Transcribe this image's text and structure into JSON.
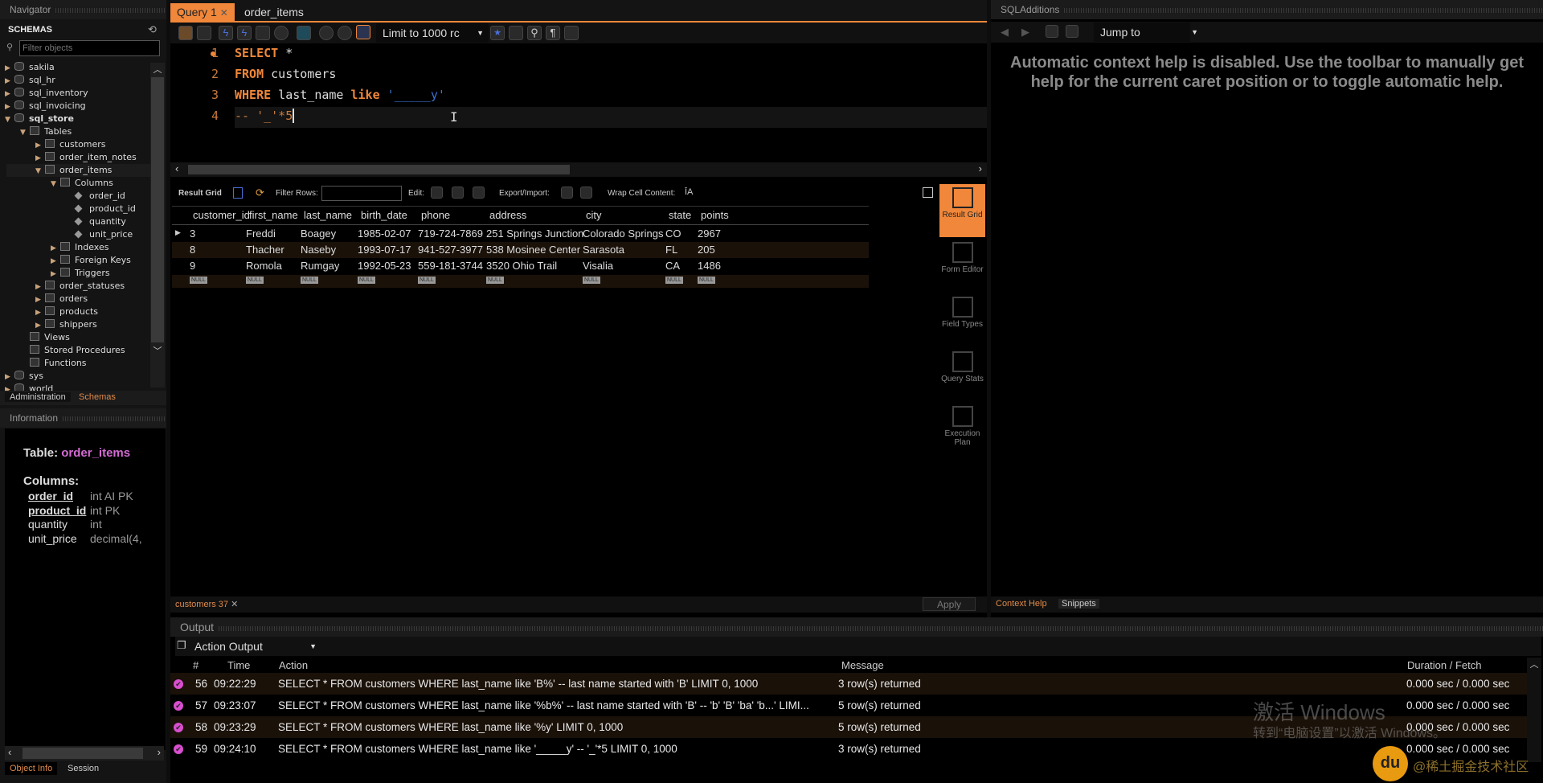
{
  "navigator": {
    "title": "Navigator",
    "schemas_label": "SCHEMAS",
    "filter_placeholder": "Filter objects",
    "tree": [
      {
        "label": "sakila",
        "depth": 0,
        "icon": "database",
        "state": "collapsed"
      },
      {
        "label": "sql_hr",
        "depth": 0,
        "icon": "database",
        "state": "collapsed"
      },
      {
        "label": "sql_inventory",
        "depth": 0,
        "icon": "database",
        "state": "collapsed"
      },
      {
        "label": "sql_invoicing",
        "depth": 0,
        "icon": "database",
        "state": "collapsed"
      },
      {
        "label": "sql_store",
        "depth": 0,
        "icon": "database",
        "state": "expanded",
        "bold": true
      },
      {
        "label": "Tables",
        "depth": 1,
        "icon": "folder",
        "state": "expanded"
      },
      {
        "label": "customers",
        "depth": 2,
        "icon": "table",
        "state": "collapsed"
      },
      {
        "label": "order_item_notes",
        "depth": 2,
        "icon": "table",
        "state": "collapsed"
      },
      {
        "label": "order_items",
        "depth": 2,
        "icon": "table",
        "state": "expanded",
        "selected": true
      },
      {
        "label": "Columns",
        "depth": 3,
        "icon": "folder",
        "state": "expanded"
      },
      {
        "label": "order_id",
        "depth": 4,
        "icon": "column"
      },
      {
        "label": "product_id",
        "depth": 4,
        "icon": "column"
      },
      {
        "label": "quantity",
        "depth": 4,
        "icon": "column"
      },
      {
        "label": "unit_price",
        "depth": 4,
        "icon": "column"
      },
      {
        "label": "Indexes",
        "depth": 3,
        "icon": "folder",
        "state": "collapsed"
      },
      {
        "label": "Foreign Keys",
        "depth": 3,
        "icon": "folder",
        "state": "collapsed"
      },
      {
        "label": "Triggers",
        "depth": 3,
        "icon": "folder",
        "state": "collapsed"
      },
      {
        "label": "order_statuses",
        "depth": 2,
        "icon": "table",
        "state": "collapsed"
      },
      {
        "label": "orders",
        "depth": 2,
        "icon": "table",
        "state": "collapsed"
      },
      {
        "label": "products",
        "depth": 2,
        "icon": "table",
        "state": "collapsed"
      },
      {
        "label": "shippers",
        "depth": 2,
        "icon": "table",
        "state": "collapsed"
      },
      {
        "label": "Views",
        "depth": 1,
        "icon": "folder"
      },
      {
        "label": "Stored Procedures",
        "depth": 1,
        "icon": "folder"
      },
      {
        "label": "Functions",
        "depth": 1,
        "icon": "folder"
      },
      {
        "label": "sys",
        "depth": 0,
        "icon": "database",
        "state": "collapsed"
      },
      {
        "label": "world",
        "depth": 0,
        "icon": "database",
        "state": "collapsed"
      }
    ],
    "tabs": [
      "Administration",
      "Schemas"
    ],
    "active_tab": "Schemas"
  },
  "information": {
    "title": "Information",
    "table_label": "Table:",
    "table_name": "order_items",
    "columns_label": "Columns:",
    "columns": [
      {
        "name": "order_id",
        "type": "int AI PK",
        "key": true
      },
      {
        "name": "product_id",
        "type": "int PK",
        "key": true
      },
      {
        "name": "quantity",
        "type": "int",
        "key": false
      },
      {
        "name": "unit_price",
        "type": "decimal(4,",
        "key": false
      }
    ],
    "tabs": [
      "Object Info",
      "Session"
    ]
  },
  "editor": {
    "tabs": [
      {
        "label": "Query 1",
        "active": true
      },
      {
        "label": "order_items",
        "active": false
      }
    ],
    "limit_select": "Limit to 1000 rc",
    "lines": [
      "1",
      "2",
      "3",
      "4"
    ]
  },
  "result": {
    "toolbar": {
      "result_grid": "Result Grid",
      "filter_rows": "Filter Rows:",
      "edit": "Edit:",
      "export_import": "Export/Import:",
      "wrap": "Wrap Cell Content:"
    },
    "columns": [
      "customer_id",
      "first_name",
      "last_name",
      "birth_date",
      "phone",
      "address",
      "city",
      "state",
      "points"
    ],
    "rows": [
      [
        "3",
        "Freddi",
        "Boagey",
        "1985-02-07",
        "719-724-7869",
        "251 Springs Junction",
        "Colorado Springs",
        "CO",
        "2967"
      ],
      [
        "8",
        "Thacher",
        "Naseby",
        "1993-07-17",
        "941-527-3977",
        "538 Mosinee Center",
        "Sarasota",
        "FL",
        "205"
      ],
      [
        "9",
        "Romola",
        "Rumgay",
        "1992-05-23",
        "559-181-3744",
        "3520 Ohio Trail",
        "Visalia",
        "CA",
        "1486"
      ]
    ],
    "null_label": "NULL",
    "side_tabs": [
      "Result Grid",
      "Form Editor",
      "Field Types",
      "Query Stats",
      "Execution Plan"
    ],
    "bottom_tab": "customers 37",
    "apply": "Apply"
  },
  "sqladditions": {
    "title": "SQLAdditions",
    "jump_to": "Jump to",
    "help_text": "Automatic context help is disabled. Use the toolbar to manually get help for the current caret position or to toggle automatic help.",
    "tabs": [
      "Context Help",
      "Snippets"
    ]
  },
  "output": {
    "title": "Output",
    "selector": "Action Output",
    "headers": [
      "#",
      "Time",
      "Action",
      "Message",
      "Duration / Fetch"
    ],
    "rows": [
      [
        "56",
        "09:22:29",
        "SELECT * FROM customers WHERE last_name like 'B%' -- last name started with 'B' LIMIT 0, 1000",
        "3 row(s) returned",
        "0.000 sec / 0.000 sec"
      ],
      [
        "57",
        "09:23:07",
        "SELECT * FROM customers WHERE last_name like '%b%' -- last name started with 'B' -- 'b' 'B' 'ba' 'b...' LIMI...",
        "5 row(s) returned",
        "0.000 sec / 0.000 sec"
      ],
      [
        "58",
        "09:23:29",
        "SELECT * FROM customers WHERE last_name like '%y' LIMIT 0, 1000",
        "5 row(s) returned",
        "0.000 sec / 0.000 sec"
      ],
      [
        "59",
        "09:24:10",
        "SELECT * FROM customers WHERE last_name like '_____y' -- '_'*5 LIMIT 0, 1000",
        "3 row(s) returned",
        "0.000 sec / 0.000 sec"
      ]
    ]
  },
  "watermark": {
    "line1": "激活 Windows",
    "line2": "转到“电脑设置”以激活 Windows。",
    "logo": "@稀土掘金技术社区"
  },
  "colors": {
    "accent": "#f0873a",
    "keyword": "#f0873a",
    "string": "#3b72d1",
    "success": "#d94fd0",
    "info_table": "#d46bd4"
  }
}
